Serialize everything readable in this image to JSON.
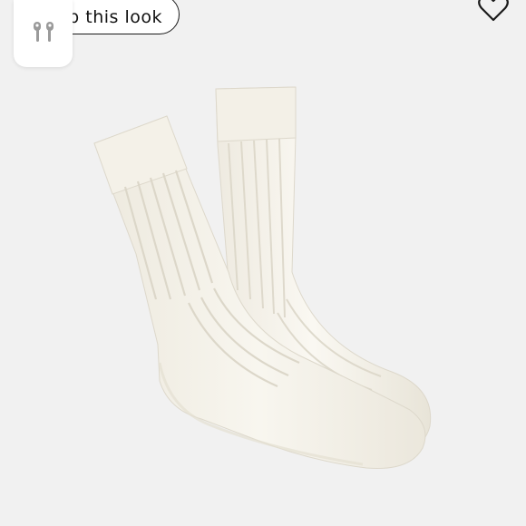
{
  "header": {
    "shop_label": "p this look"
  },
  "icons": {
    "app_tile": "airpods-icon",
    "favorite": "heart-icon"
  },
  "colors": {
    "background": "#f1f1f1",
    "sock": "#f6f3ea"
  }
}
